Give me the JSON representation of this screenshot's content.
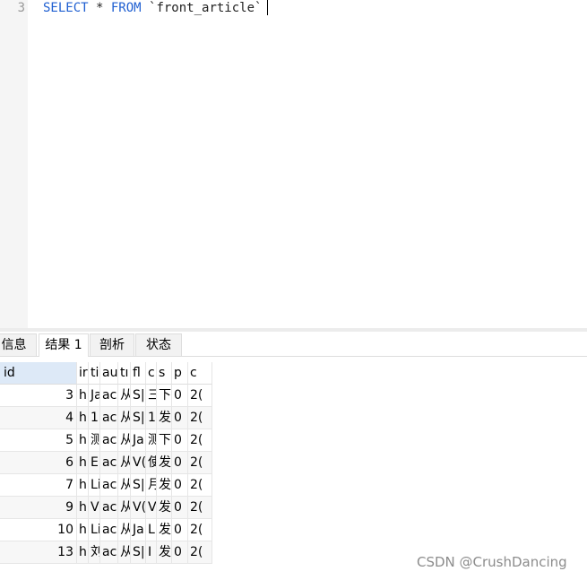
{
  "editor": {
    "line_number": "3",
    "sql_keyword_select": "SELECT",
    "sql_star": " * ",
    "sql_keyword_from": "FROM",
    "sql_table": " `front_article`"
  },
  "tabs": [
    {
      "label": "信息",
      "active": false
    },
    {
      "label": "结果 1",
      "active": true
    },
    {
      "label": "剖析",
      "active": false
    },
    {
      "label": "状态",
      "active": false
    }
  ],
  "grid": {
    "columns": [
      "id",
      "ir",
      "ti",
      "au",
      "tı",
      "fl",
      "c",
      "s",
      "p",
      "c"
    ],
    "rows": [
      [
        "3",
        "h",
        "Ja",
        "ac",
        "从",
        "S|",
        "三",
        "下",
        "0",
        "2("
      ],
      [
        "4",
        "h",
        "1",
        "ac",
        "从",
        "S|",
        "1(",
        "发",
        "0",
        "2("
      ],
      [
        "5",
        "h",
        "测",
        "ac",
        "从",
        "Ja",
        "测",
        "下",
        "0",
        "2("
      ],
      [
        "6",
        "h",
        "El",
        "ac",
        "从",
        "V(",
        "使",
        "发",
        "0",
        "2("
      ],
      [
        "7",
        "h",
        "Li",
        "ac",
        "从",
        "S|",
        "月",
        "发",
        "0",
        "2("
      ],
      [
        "9",
        "h",
        "V",
        "ac",
        "从",
        "V(",
        "V",
        "发",
        "0",
        "2("
      ],
      [
        "10",
        "h",
        "Li",
        "ac",
        "从",
        "Ja",
        "L",
        "发",
        "0",
        "2("
      ],
      [
        "13",
        "h",
        "刘",
        "ac",
        "从",
        "S|",
        "I",
        "发",
        "0",
        "2("
      ]
    ]
  },
  "watermark": "CSDN @CrushDancing"
}
